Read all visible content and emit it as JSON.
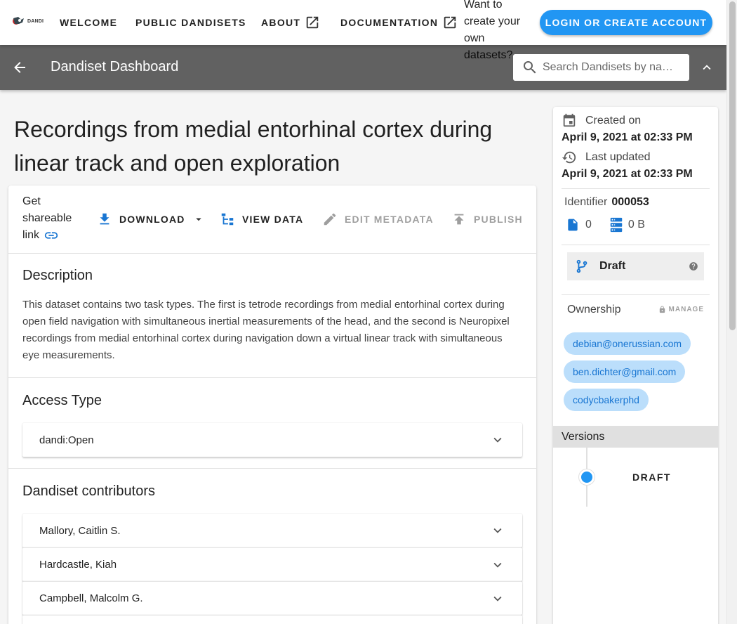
{
  "nav": {
    "logo_text": "DANDI",
    "links": {
      "welcome": "WELCOME",
      "public": "PUBLIC DANDISETS",
      "about": "ABOUT",
      "docs": "DOCUMENTATION"
    },
    "note": "Want to create your own datasets?",
    "login": "LOGIN OR CREATE ACCOUNT"
  },
  "appbar": {
    "title": "Dandiset Dashboard",
    "search_placeholder": "Search Dandisets by na…"
  },
  "dandiset": {
    "title": "Recordings from medial entorhinal cortex during linear track and open exploration",
    "toolbar": {
      "share_line1": "Get",
      "share_line2": "shareable",
      "share_line3": "link",
      "download": "DOWNLOAD",
      "view_data": "VIEW DATA",
      "edit_metadata": "EDIT METADATA",
      "publish": "PUBLISH"
    },
    "description_title": "Description",
    "description": "This dataset contains two task types. The first is tetrode recordings from medial entorhinal cortex during open field navigation with simultaneous inertial measurements of the head, and the second is Neuropixel recordings from medial entorhinal cortex during navigation down a virtual linear track with simultaneous eye measurements.",
    "access_title": "Access Type",
    "access_value": "dandi:Open",
    "contributors_title": "Dandiset contributors",
    "contributors": [
      "Mallory, Caitlin S.",
      "Hardcastle, Kiah",
      "Campbell, Malcolm G."
    ]
  },
  "sidebar": {
    "created_label": "Created on",
    "created_value": "April 9, 2021 at 02:33 PM",
    "updated_label": "Last updated",
    "updated_value": "April 9, 2021 at 02:33 PM",
    "identifier_label": "Identifier",
    "identifier_value": "000053",
    "file_count": "0",
    "size": "0 B",
    "status": "Draft",
    "ownership_label": "Ownership",
    "manage_label": "MANAGE",
    "owners": [
      "debian@onerussian.com",
      "ben.dichter@gmail.com",
      "codycbakerphd"
    ],
    "versions_label": "Versions",
    "version": "DRAFT"
  },
  "colors": {
    "accent": "#2196f3",
    "appbar": "#616161",
    "chip_bg": "#bbdefb",
    "chip_text": "#1976d2"
  }
}
